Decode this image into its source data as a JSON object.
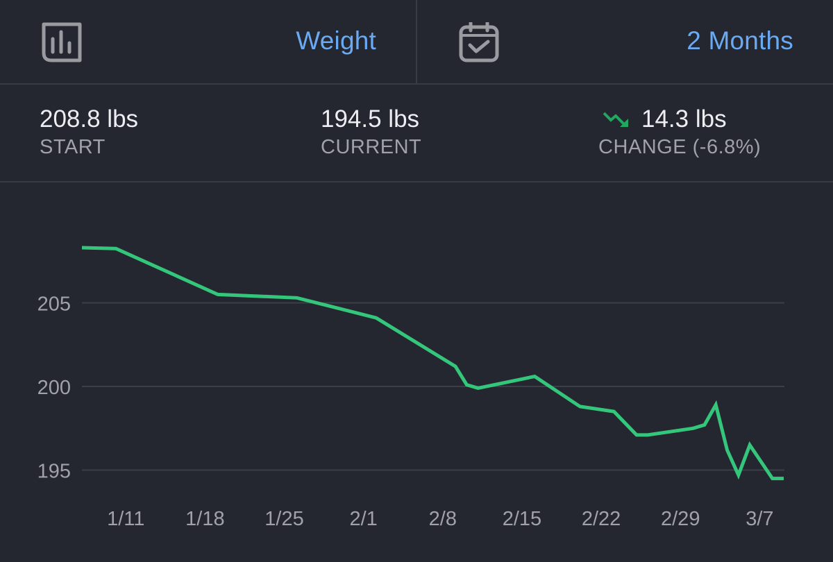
{
  "header": {
    "metric": {
      "icon": "bar-chart-icon",
      "label": "Weight"
    },
    "period": {
      "icon": "calendar-check-icon",
      "label": "2 Months"
    }
  },
  "stats": {
    "start": {
      "value": "208.8 lbs",
      "label": "START"
    },
    "current": {
      "value": "194.5 lbs",
      "label": "CURRENT"
    },
    "change": {
      "icon": "trend-down-icon",
      "value": "14.3 lbs",
      "label": "CHANGE (-6.8%)"
    }
  },
  "colors": {
    "accent": "#6aaaf2",
    "line": "#34c77b",
    "trend_down": "#22a660",
    "background": "#242630",
    "grid": "#3c3e48"
  },
  "chart_data": {
    "type": "line",
    "title": "",
    "xlabel": "",
    "ylabel": "",
    "ylim": [
      192.9,
      211.2
    ],
    "yticks": [
      205,
      200,
      195
    ],
    "xticks": [
      "1/11",
      "1/18",
      "1/25",
      "2/1",
      "2/8",
      "2/15",
      "2/22",
      "2/29",
      "3/7"
    ],
    "xtick_days": [
      4,
      11,
      18,
      25,
      32,
      39,
      46,
      53,
      60
    ],
    "xlim_days": [
      0,
      62.5
    ],
    "grid": true,
    "legend": "none",
    "series": [
      {
        "name": "Weight",
        "x_days": [
          0,
          3,
          12,
          19,
          26,
          33,
          34,
          35,
          40,
          44,
          47,
          49,
          50,
          54,
          55,
          56,
          57,
          58,
          59,
          61,
          62
        ],
        "dates": [
          "1/7",
          "1/10",
          "1/19",
          "1/26",
          "2/2",
          "2/9",
          "2/10",
          "2/11",
          "2/16",
          "2/20",
          "2/23",
          "2/25",
          "2/26",
          "3/1",
          "3/2",
          "3/3",
          "3/4",
          "3/5",
          "3/6",
          "3/8",
          "3/9"
        ],
        "values": [
          208.3,
          208.25,
          205.5,
          205.3,
          204.1,
          201.2,
          200.1,
          199.9,
          200.6,
          198.8,
          198.5,
          197.1,
          197.1,
          197.5,
          197.7,
          198.9,
          196.2,
          194.7,
          196.5,
          194.5,
          194.5
        ]
      }
    ]
  }
}
